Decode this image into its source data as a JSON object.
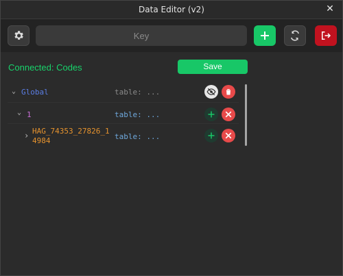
{
  "window": {
    "title": "Data Editor (v2)"
  },
  "toolbar": {
    "key_placeholder": "Key",
    "settings_icon": "gear-icon",
    "add_icon": "plus-icon",
    "refresh_icon": "refresh-icon",
    "exit_icon": "logout-icon"
  },
  "status": {
    "text": "Connected: Codes"
  },
  "save": {
    "label": "Save"
  },
  "tree": {
    "rows": [
      {
        "key": "Global",
        "value": "table: ...",
        "key_color": "#5b7ee5",
        "value_dim": true
      },
      {
        "key": "1",
        "value": "table: ...",
        "key_color": "#c86fd6",
        "value_dim": false
      },
      {
        "key": "HAG_74353_27826_1\n4984",
        "value": "table: ...",
        "key_color": "#e6932e",
        "value_dim": false
      }
    ]
  },
  "colors": {
    "accent_green": "#18c767",
    "danger_red": "#e84a4a",
    "exit_red": "#c1121f",
    "link_blue": "#6fa8dc"
  }
}
